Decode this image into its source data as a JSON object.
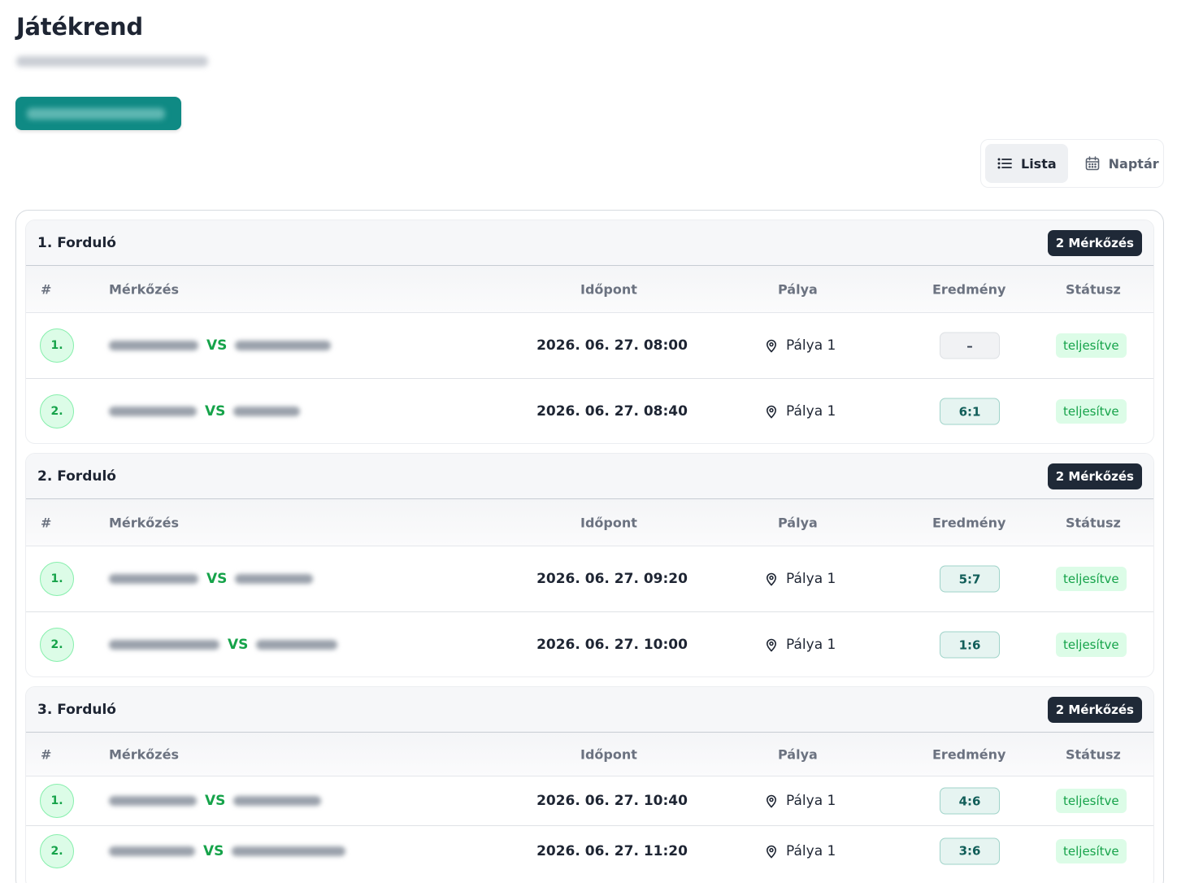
{
  "page": {
    "title": "Játékrend"
  },
  "view_toggle": {
    "list_label": "Lista",
    "calendar_label": "Naptár",
    "active": "list"
  },
  "columns": {
    "num": "#",
    "match": "Mérkőzés",
    "time": "Időpont",
    "venue": "Pálya",
    "result": "Eredmény",
    "status": "Státusz"
  },
  "vs_label": "VS",
  "rounds": [
    {
      "title": "1. Forduló",
      "count": "2 Mérkőzés",
      "matches": [
        {
          "num": "1.",
          "time": "2026. 06. 27. 08:00",
          "venue": "Pálya 1",
          "result": "–",
          "status": "teljesítve"
        },
        {
          "num": "2.",
          "time": "2026. 06. 27. 08:40",
          "venue": "Pálya 1",
          "result": "6:1",
          "status": "teljesítve"
        }
      ]
    },
    {
      "title": "2. Forduló",
      "count": "2 Mérkőzés",
      "matches": [
        {
          "num": "1.",
          "time": "2026. 06. 27. 09:20",
          "venue": "Pálya 1",
          "result": "5:7",
          "status": "teljesítve"
        },
        {
          "num": "2.",
          "time": "2026. 06. 27. 10:00",
          "venue": "Pálya 1",
          "result": "1:6",
          "status": "teljesítve"
        }
      ]
    },
    {
      "title": "3. Forduló",
      "count": "2 Mérkőzés",
      "matches": [
        {
          "num": "1.",
          "time": "2026. 06. 27. 10:40",
          "venue": "Pálya 1",
          "result": "4:6",
          "status": "teljesítve"
        },
        {
          "num": "2.",
          "time": "2026. 06. 27. 11:20",
          "venue": "Pálya 1",
          "result": "3:6",
          "status": "teljesítve"
        }
      ]
    }
  ],
  "colors": {
    "accent_teal": "#0f8a84",
    "success_green": "#16a34a",
    "dark_badge": "#1f2937"
  }
}
